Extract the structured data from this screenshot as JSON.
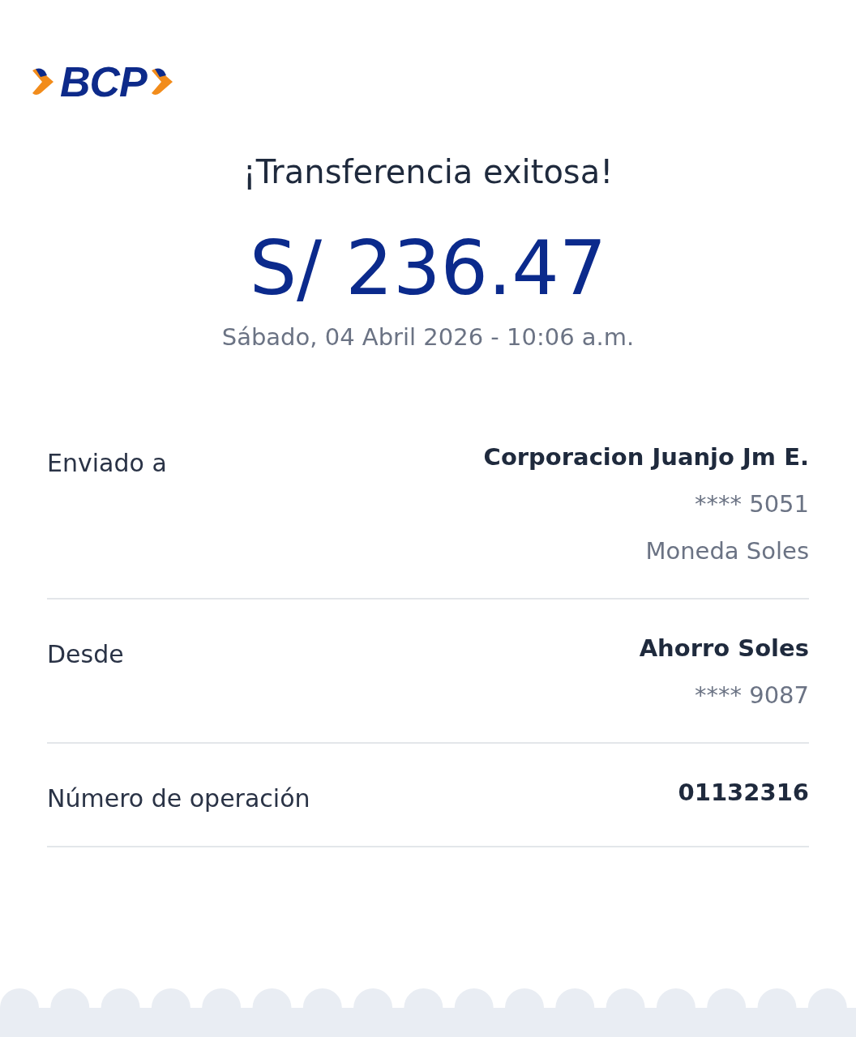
{
  "logo": "BCP",
  "title": "¡Transferencia exitosa!",
  "amount": "S/ 236.47",
  "datetime": "Sábado, 04 Abril 2026 - 10:06 a.m.",
  "details": [
    {
      "label": "Enviado a",
      "values": [
        {
          "text": "Corporacion Juanjo Jm E.",
          "kind": "strong"
        },
        {
          "text": "**** 5051",
          "kind": "muted"
        },
        {
          "text": "Moneda Soles",
          "kind": "muted"
        }
      ]
    },
    {
      "label": "Desde",
      "values": [
        {
          "text": "Ahorro Soles",
          "kind": "strong"
        },
        {
          "text": "**** 9087",
          "kind": "muted"
        }
      ]
    },
    {
      "label": "Número de operación",
      "values": [
        {
          "text": "01132316",
          "kind": "strong"
        }
      ]
    }
  ]
}
